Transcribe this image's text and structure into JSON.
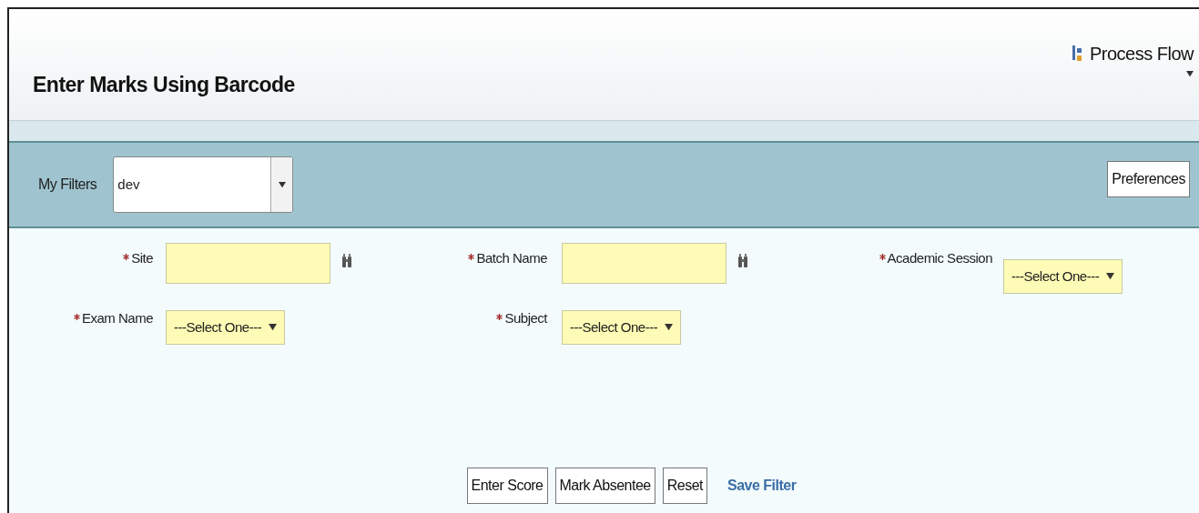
{
  "page": {
    "title": "Enter Marks Using Barcode"
  },
  "process_flow": {
    "label": "Process Flow"
  },
  "filter_bar": {
    "label": "My Filters",
    "value": "dev",
    "preferences": "Preferences"
  },
  "fields": [
    {
      "kind": "lookup",
      "label": "Site",
      "required": true
    },
    {
      "kind": "lookup",
      "label": "Batch Name",
      "required": true
    },
    {
      "kind": "select",
      "label": "Academic Session",
      "required": true,
      "value": "---Select One---"
    },
    {
      "kind": "select",
      "label": "Exam Name",
      "required": true,
      "value": "---Select One---"
    },
    {
      "kind": "select",
      "label": "Subject",
      "required": true,
      "value": "---Select One---"
    }
  ],
  "actions": [
    {
      "kind": "button",
      "label": "Enter Score"
    },
    {
      "kind": "button",
      "label": "Mark Absentee"
    },
    {
      "kind": "button",
      "label": "Reset"
    },
    {
      "kind": "link",
      "label": "Save Filter"
    }
  ]
}
